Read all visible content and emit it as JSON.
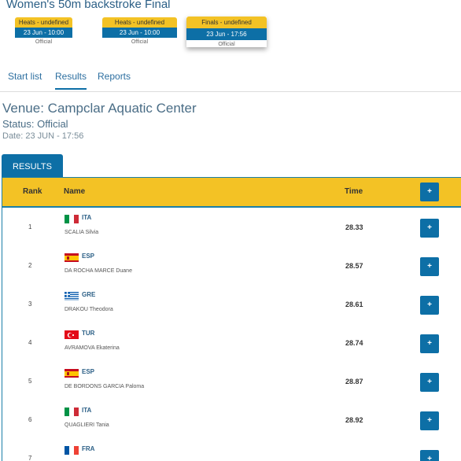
{
  "event_title": "Women's 50m backstroke Final",
  "phases": [
    {
      "label": "Heats - undefined",
      "date": "23 Jun - 10:00",
      "status": "Official"
    },
    {
      "label": "Heats - undefined",
      "date": "23 Jun - 10:00",
      "status": "Official"
    },
    {
      "label": "Finals - undefined",
      "date": "23 Jun - 17:56",
      "status": "Official"
    }
  ],
  "tabs": [
    "Start list",
    "Results",
    "Reports"
  ],
  "active_tab": "Results",
  "venue": "Venue: Campclar Aquatic Center",
  "status": "Status: Official",
  "date": "Date: 23 JUN - 17:56",
  "results_label": "RESULTS",
  "table": {
    "headers": {
      "rank": "Rank",
      "name": "Name",
      "time": "Time",
      "action": "+"
    },
    "rows": [
      {
        "rank": "1",
        "country": "ITA",
        "athlete": "SCALIA Silvia",
        "time": "28.33",
        "action": "+"
      },
      {
        "rank": "2",
        "country": "ESP",
        "athlete": "DA ROCHA MARCE Duane",
        "time": "28.57",
        "action": "+"
      },
      {
        "rank": "3",
        "country": "GRE",
        "athlete": "DRAKOU Theodora",
        "time": "28.61",
        "action": "+"
      },
      {
        "rank": "4",
        "country": "TUR",
        "athlete": "AVRAMOVA Ekaterina",
        "time": "28.74",
        "action": "+"
      },
      {
        "rank": "5",
        "country": "ESP",
        "athlete": "DE BORDONS GARCIA Paloma",
        "time": "28.87",
        "action": "+"
      },
      {
        "rank": "6",
        "country": "ITA",
        "athlete": "QUAGLIERI Tania",
        "time": "28.92",
        "action": "+"
      },
      {
        "rank": "7",
        "country": "FRA",
        "athlete": "",
        "time": "",
        "action": "+"
      }
    ]
  },
  "colors": {
    "accent": "#0d6fa6",
    "header_yellow": "#f3c225",
    "title": "#2b5f86"
  }
}
